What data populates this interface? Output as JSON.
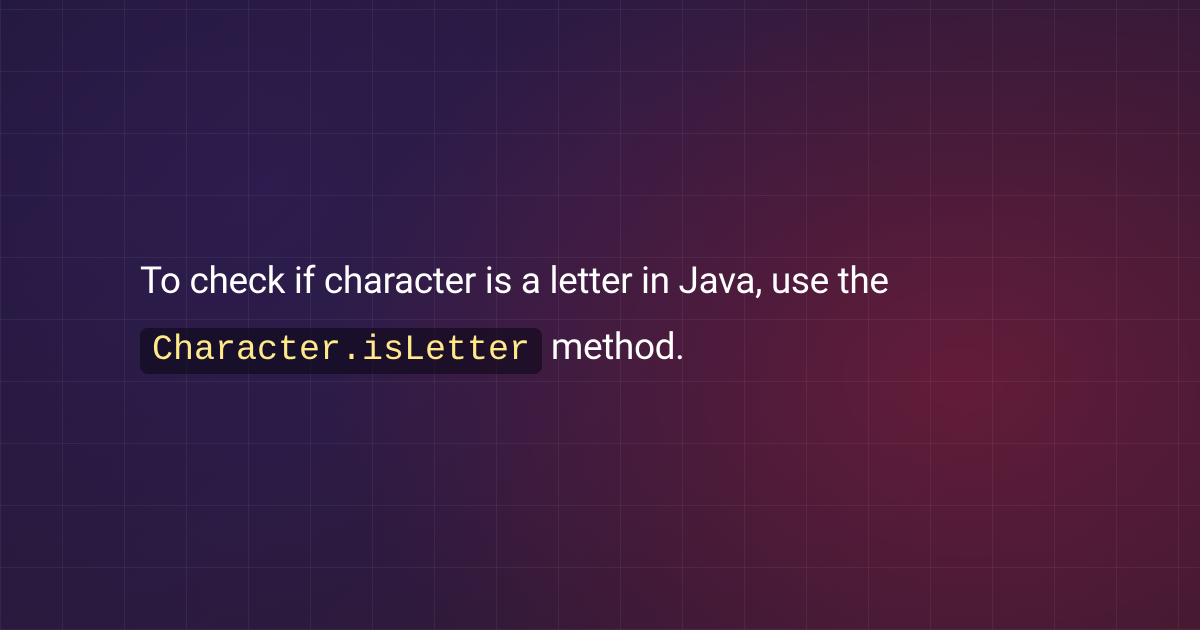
{
  "sentence": {
    "prefix": "To check if character is a letter in Java, use the ",
    "code": "Character.isLetter",
    "suffix": " method."
  }
}
